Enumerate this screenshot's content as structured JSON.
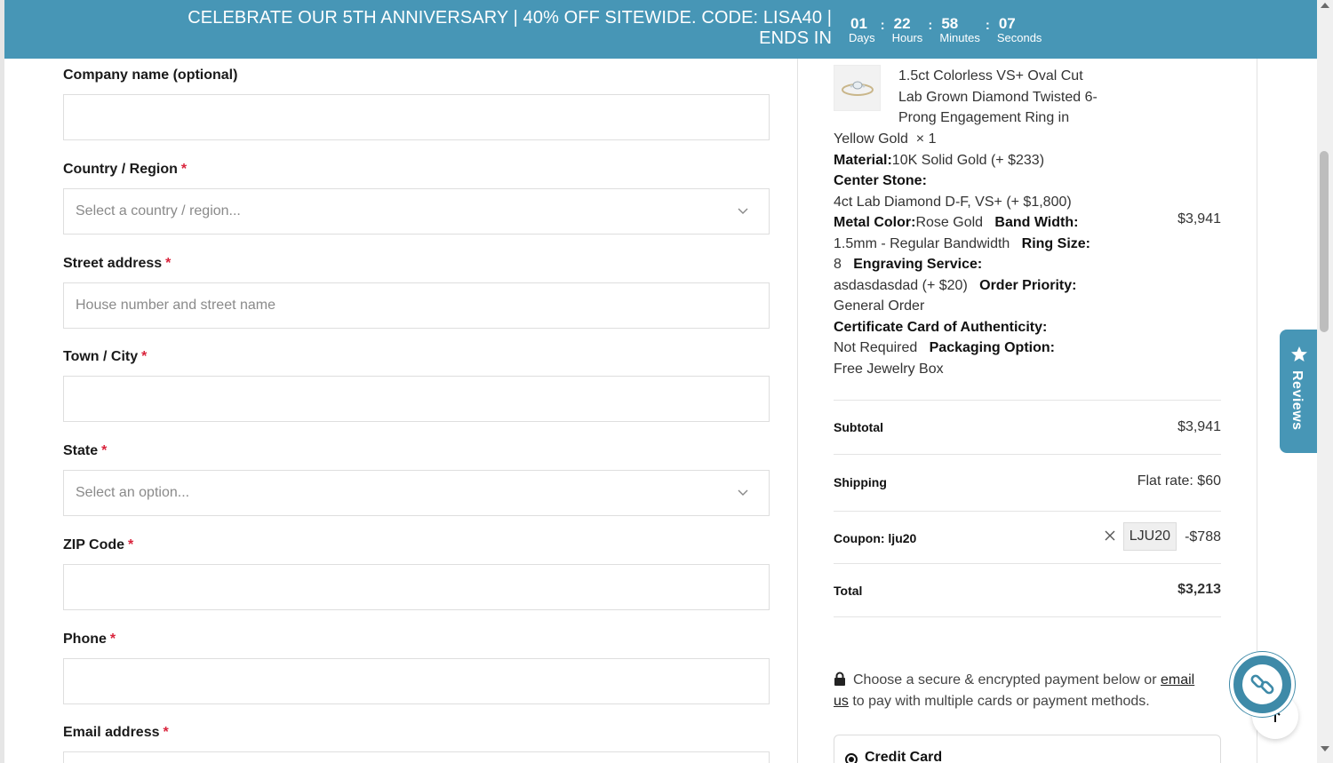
{
  "banner": {
    "line1": "CELEBRATE OUR 5TH ANNIVERSARY | 40% OFF SITEWIDE. CODE: LISA40 |",
    "line2": "ENDS IN",
    "countdown": [
      {
        "value": "01",
        "label": "Days"
      },
      {
        "value": "22",
        "label": "Hours"
      },
      {
        "value": "58",
        "label": "Minutes"
      },
      {
        "value": "07",
        "label": "Seconds"
      }
    ],
    "separator": ":"
  },
  "form": {
    "required_mark": "*",
    "company": {
      "label": "Company name (optional)",
      "value": ""
    },
    "country": {
      "label": "Country / Region",
      "placeholder": "Select a country / region..."
    },
    "street": {
      "label": "Street address",
      "placeholder": "House number and street name"
    },
    "city": {
      "label": "Town / City",
      "value": ""
    },
    "state": {
      "label": "State",
      "placeholder": "Select an option..."
    },
    "zip": {
      "label": "ZIP Code",
      "value": ""
    },
    "phone": {
      "label": "Phone",
      "value": ""
    },
    "email": {
      "label": "Email address",
      "value": ""
    }
  },
  "summary": {
    "product": {
      "title": "1.5ct Colorless VS+ Oval Cut Lab Grown Diamond Twisted 6-Prong Engagement Ring in",
      "title_tail": "Yellow Gold",
      "qty": "× 1",
      "price": "$3,941",
      "options": [
        {
          "k": "Material:",
          "v": "10K Solid Gold (+ $233)"
        },
        {
          "k": "Center Stone:",
          "v": "4ct Lab Diamond D-F, VS+ (+ $1,800)"
        },
        {
          "k": "Metal Color:",
          "v": "Rose Gold"
        },
        {
          "k": "Band Width:",
          "v": "1.5mm - Regular Bandwidth"
        },
        {
          "k": "Ring Size:",
          "v": "8"
        },
        {
          "k": "Engraving Service:",
          "v": "asdasdasdad (+ $20)"
        },
        {
          "k": "Order Priority:",
          "v": "General Order"
        },
        {
          "k": "Certificate Card of Authenticity:",
          "v": "Not Required"
        },
        {
          "k": "Packaging Option:",
          "v": "Free Jewelry Box"
        }
      ]
    },
    "subtotal": {
      "label": "Subtotal",
      "value": "$3,941"
    },
    "shipping": {
      "label": "Shipping",
      "value": "Flat rate: $60"
    },
    "coupon": {
      "label": "Coupon: lju20",
      "code": "LJU20",
      "value": "-$788"
    },
    "total": {
      "label": "Total",
      "value": "$3,213"
    },
    "secure_note": {
      "text1": "Choose a secure & encrypted payment below or",
      "link1": "email",
      "link2": "us",
      "text2": "to pay with multiple cards or payment methods."
    },
    "payment_method": "Credit Card"
  },
  "reviews_tab": {
    "label": "Reviews"
  },
  "icons": {
    "chevron": "chevron-down-icon",
    "lock": "lock-icon",
    "close": "close-icon",
    "star": "star-icon",
    "link": "link-icon",
    "arrow_up": "arrow-up-icon"
  },
  "colors": {
    "brand": "#4796b6",
    "required": "#d9243c"
  }
}
